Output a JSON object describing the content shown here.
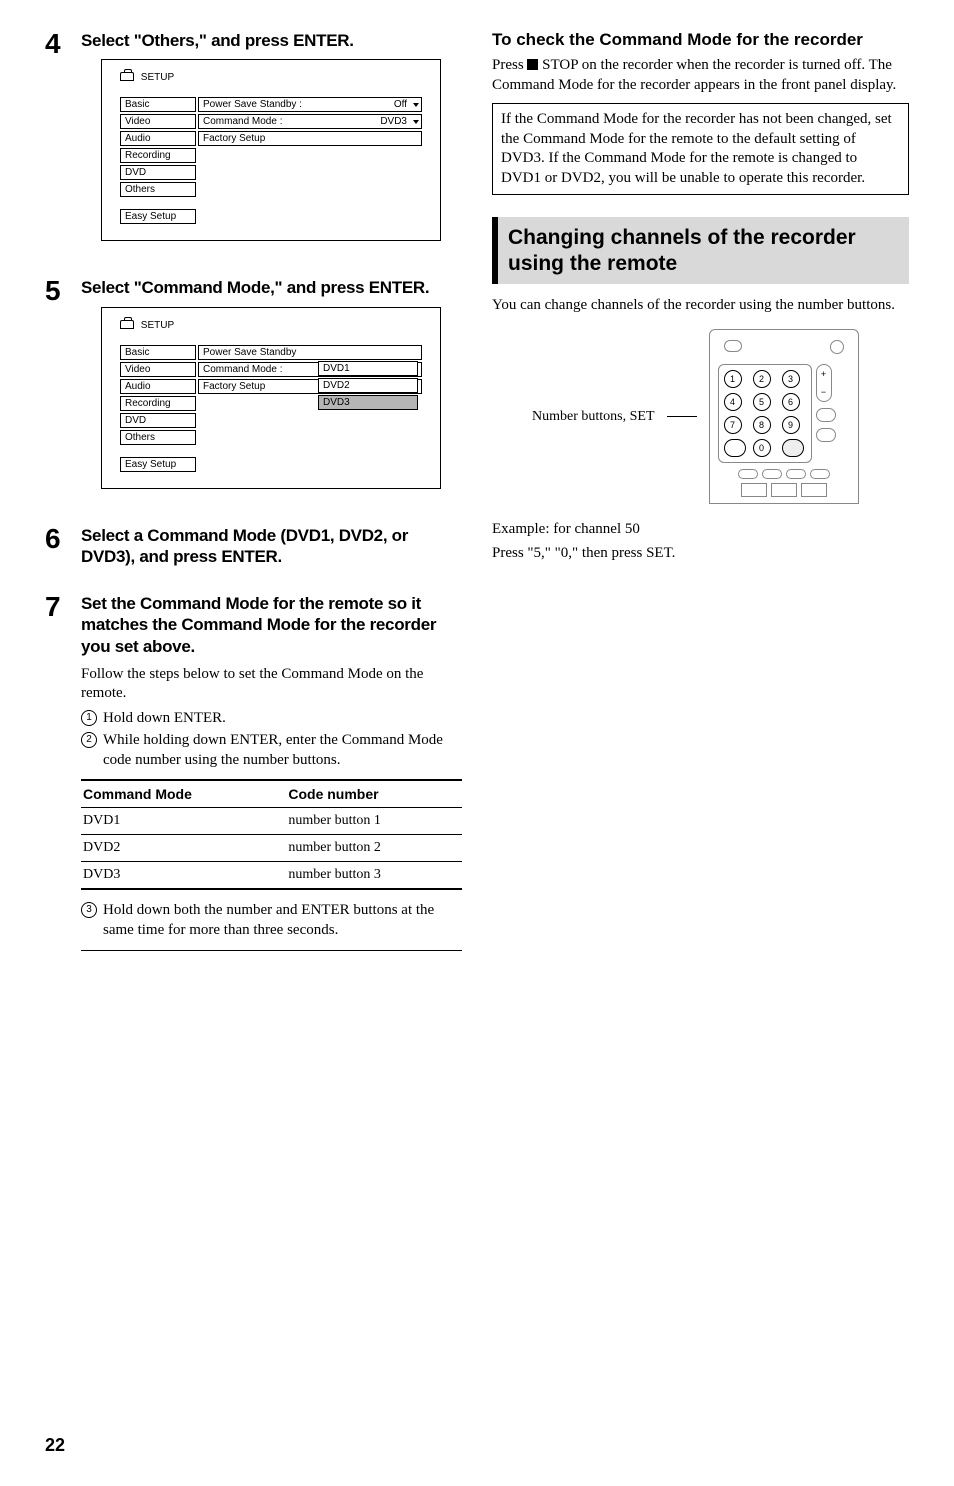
{
  "step4": {
    "num": "4",
    "title": "Select \"Others,\" and press ENTER."
  },
  "setup1": {
    "header": "SETUP",
    "tabs": [
      "Basic",
      "Video",
      "Audio",
      "Recording",
      "DVD",
      "Others"
    ],
    "easy": "Easy Setup",
    "rows": [
      {
        "label": "Power Save Standby :",
        "val": "Off",
        "arrow": true
      },
      {
        "label": "Command Mode :",
        "val": "DVD3",
        "arrow": true
      },
      {
        "label": "Factory Setup",
        "val": "",
        "arrow": false
      }
    ]
  },
  "step5": {
    "num": "5",
    "title": "Select \"Command Mode,\" and press ENTER."
  },
  "setup2": {
    "header": "SETUP",
    "tabs": [
      "Basic",
      "Video",
      "Audio",
      "Recording",
      "DVD",
      "Others"
    ],
    "easy": "Easy Setup",
    "rows": [
      {
        "label": "Power Save Standby"
      },
      {
        "label": "Command Mode :"
      },
      {
        "label": "Factory Setup"
      }
    ],
    "sub": [
      "DVD1",
      "DVD2",
      "DVD3"
    ]
  },
  "step6": {
    "num": "6",
    "title": "Select a Command Mode (DVD1, DVD2, or DVD3), and press ENTER."
  },
  "step7": {
    "num": "7",
    "title": "Set the Command Mode for the remote so it matches the Command Mode for the recorder you set above.",
    "intro": "Follow the steps below to set the Command Mode on the remote.",
    "c1": "Hold down ENTER.",
    "c2": "While holding down ENTER, enter the Command Mode code number using the number buttons.",
    "c3": "Hold down both the number and ENTER buttons at the same time for more than three seconds."
  },
  "cm_table": {
    "headers": [
      "Command Mode",
      "Code number"
    ],
    "rows": [
      [
        "DVD1",
        "number button 1"
      ],
      [
        "DVD2",
        "number button 2"
      ],
      [
        "DVD3",
        "number button 3"
      ]
    ]
  },
  "right": {
    "check_heading": "To check the Command Mode for the recorder",
    "check_p1a": "Press ",
    "check_p1b": " STOP on the recorder when the recorder is turned off. The Command Mode for the recorder appears in the front panel display.",
    "note": "If the Command Mode for the recorder has not been changed, set the Command Mode for the remote to the default setting of DVD3. If the Command Mode for the remote is changed to DVD1 or DVD2, you will be unable to operate this recorder.",
    "section": "Changing channels of the recorder using the remote",
    "section_p": "You can change channels of the recorder using the number buttons.",
    "remote_label": "Number buttons, SET",
    "example": "Example: for channel 50",
    "example2": "Press \"5,\" \"0,\" then press SET."
  },
  "numpad": [
    "1",
    "2",
    "3",
    "4",
    "5",
    "6",
    "7",
    "8",
    "9",
    "",
    "0",
    ""
  ],
  "page": "22"
}
